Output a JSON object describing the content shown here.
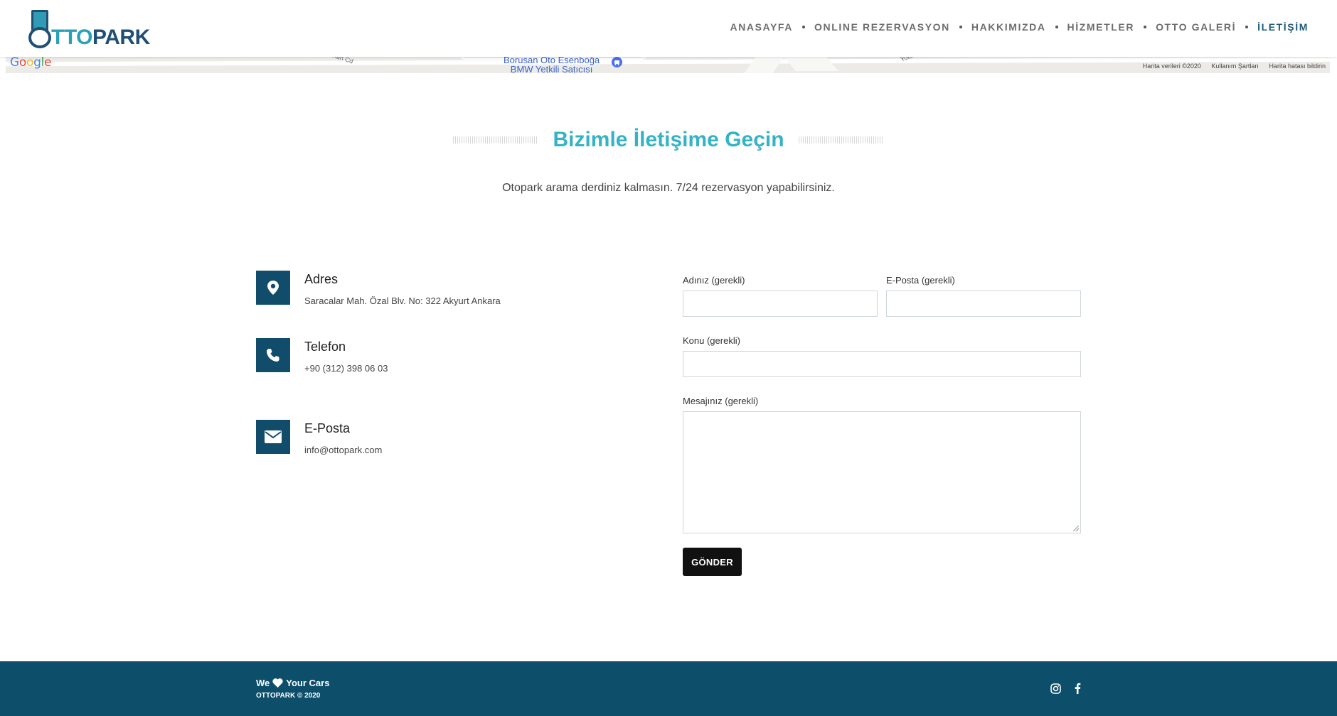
{
  "brand": {
    "logo_part1": "TTO",
    "logo_part2": "PARK"
  },
  "nav": {
    "items": [
      {
        "label": "ANASAYFA"
      },
      {
        "label": "ONLINE REZERVASYON"
      },
      {
        "label": "HAKKIMIZDA"
      },
      {
        "label": "HİZMETLER"
      },
      {
        "label": "OTTO GALERİ"
      },
      {
        "label": "İLETİŞİM"
      }
    ],
    "active_index": 5
  },
  "map": {
    "place_line1": "Borusan Oto Esenboğa",
    "place_line2": "BMW Yetkili Satıcısı",
    "street1": "al Özkan Cd",
    "street2": "Yolu",
    "google_letters": [
      "G",
      "o",
      "o",
      "g",
      "l",
      "e"
    ],
    "footer": [
      "Harita verileri ©2020",
      "Kullanım Şartları",
      "Harita hatası bildirin"
    ]
  },
  "contact": {
    "title": "Bizimle İletişime Geçin",
    "subtitle": "Otopark arama derdiniz kalmasın. 7/24 rezervasyon yapabilirsiniz.",
    "info": [
      {
        "title": "Adres",
        "value": "Saracalar Mah. Özal Blv. No: 322 Akyurt Ankara",
        "icon": "map-pin-icon"
      },
      {
        "title": "Telefon",
        "value": "+90 (312) 398 06 03",
        "icon": "phone-icon"
      },
      {
        "title": "E-Posta",
        "value": "info@ottopark.com",
        "icon": "envelope-icon"
      }
    ]
  },
  "form": {
    "name_label": "Adınız (gerekli)",
    "name_value": "",
    "email_label": "E-Posta (gerekli)",
    "email_value": "",
    "subject_label": "Konu (gerekli)",
    "subject_value": "",
    "message_label": "Mesajınız (gerekli)",
    "message_value": "",
    "submit_label": "GÖNDER"
  },
  "footer": {
    "tag_we": "We",
    "tag_rest": "Your Cars",
    "copyright": "OTTOPARK © 2020"
  },
  "colors": {
    "accent": "#35b3c6",
    "primary": "#114d6b",
    "footer_bg": "#0d4e6a"
  }
}
